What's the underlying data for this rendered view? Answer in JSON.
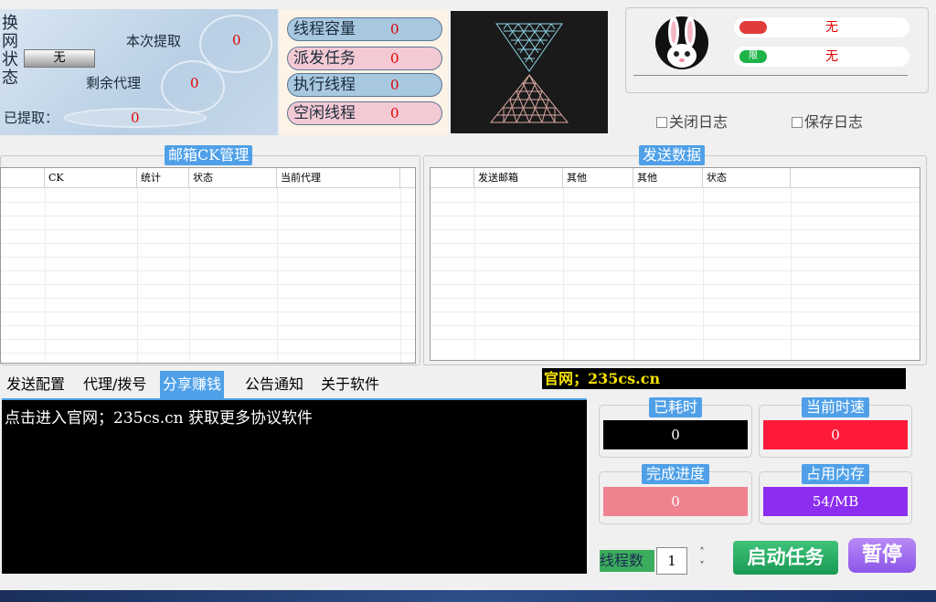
{
  "status_panel": {
    "net_status_label": "换网状态",
    "net_status_value": "无",
    "this_extract_label": "本次提取",
    "this_extract_value": "0",
    "remaining_proxy_label": "剩余代理",
    "remaining_proxy_value": "0",
    "extracted_label": "已提取：",
    "extracted_value": "0"
  },
  "threads": [
    {
      "label": "线程容量",
      "value": "0",
      "style": "blue"
    },
    {
      "label": "派发任务",
      "value": "0",
      "style": "pink"
    },
    {
      "label": "执行线程",
      "value": "0",
      "style": "blue"
    },
    {
      "label": "空闲线程",
      "value": "0",
      "style": "pink"
    }
  ],
  "user": {
    "avatar_icon": "bunny-avatar-icon",
    "field1_icon": "user-icon",
    "field1_value": "无",
    "field2_icon": "limit-icon",
    "field2_glyph": "限",
    "field2_value": "无"
  },
  "options": {
    "close_log": "关闭日志",
    "save_log": "保存日志"
  },
  "mailbox_panel": {
    "title": "邮箱CK管理",
    "columns": [
      "",
      "CK",
      "统计",
      "状态",
      "当前代理",
      ""
    ]
  },
  "send_panel": {
    "title": "发送数据",
    "columns": [
      "",
      "发送邮箱",
      "其他",
      "其他",
      "状态",
      ""
    ]
  },
  "tabs": [
    "发送配置",
    "代理/拨号",
    "分享赚钱",
    "公告通知",
    "关于软件"
  ],
  "active_tab": 2,
  "site_banner": "官网；235cs.cn",
  "console_text": "点击进入官网；235cs.cn   获取更多协议软件",
  "stats": {
    "elapsed": {
      "label": "已耗时",
      "value": "0",
      "bg": "#000000",
      "fg": "#ffffff"
    },
    "speed": {
      "label": "当前时速",
      "value": "0",
      "bg": "#ff1a3a",
      "fg": "#ffffff"
    },
    "progress": {
      "label": "完成进度",
      "value": "0",
      "bg": "#f0828f",
      "fg": "#ffffff"
    },
    "memory": {
      "label": "占用内存",
      "value": "54/MB",
      "bg": "#8c2ef0",
      "fg": "#ffffff"
    }
  },
  "controls": {
    "thread_count_label": "线程数",
    "thread_count_value": "1",
    "spin_up": "˄",
    "spin_down": "˅",
    "start_label": "启动任务",
    "pause_label": "暂停"
  },
  "colors": {
    "accent": "#4fa0e8",
    "start": "#22a35f",
    "pause": "#9a66f0",
    "banner_text": "#f5e100"
  }
}
